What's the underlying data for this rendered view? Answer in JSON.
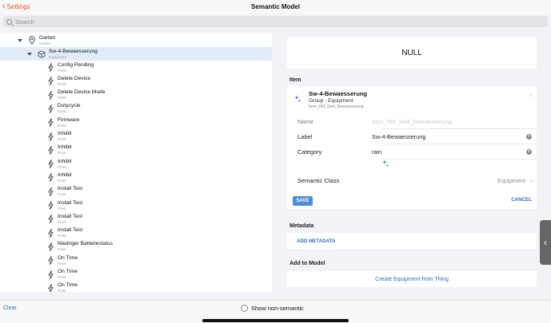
{
  "nav": {
    "back_label": "Settings",
    "title": "Semantic Model"
  },
  "search": {
    "placeholder": "Search"
  },
  "tree": {
    "location": {
      "label": "Garten",
      "sublabel": "Garten"
    },
    "equipment": {
      "label": "Sw-4-Bewaesserung",
      "sublabel": "Equipment"
    },
    "points": [
      {
        "label": "Config Pending",
        "sublabel": "Point"
      },
      {
        "label": "Delete Device",
        "sublabel": "Point"
      },
      {
        "label": "Delete Device Mode",
        "sublabel": "Point"
      },
      {
        "label": "Dutycycle",
        "sublabel": "Point"
      },
      {
        "label": "Firmware",
        "sublabel": "Point"
      },
      {
        "label": "Inhibit",
        "sublabel": "Point"
      },
      {
        "label": "Inhibit",
        "sublabel": "Point"
      },
      {
        "label": "Inhibit",
        "sublabel": "Point"
      },
      {
        "label": "Inhibit",
        "sublabel": "Point"
      },
      {
        "label": "Install Test",
        "sublabel": "Point"
      },
      {
        "label": "Install Test",
        "sublabel": "Point"
      },
      {
        "label": "Install Test",
        "sublabel": "Point"
      },
      {
        "label": "Install Test",
        "sublabel": "Point"
      },
      {
        "label": "Niedriger Batteriestatus",
        "sublabel": "Point"
      },
      {
        "label": "On Time",
        "sublabel": "Point"
      },
      {
        "label": "On Time",
        "sublabel": "Point"
      },
      {
        "label": "On Time",
        "sublabel": "Point"
      }
    ]
  },
  "detail": {
    "state": "NULL",
    "item_section": "Item",
    "item": {
      "name": "Sw-4-Bewaesserung",
      "type": "Group - Equipment",
      "item_name": "Item_HM_Sw4_Bewaesserung"
    },
    "fields": {
      "name_label": "Name",
      "name_placeholder": "Item_HM_Sw4_Bewaesserung",
      "label_label": "Label",
      "label_value": "Sw-4-Bewaesserung",
      "category_label": "Category",
      "category_value": "rain",
      "semantic_label": "Semantic Class",
      "semantic_value": "Equipment"
    },
    "save_label": "SAVE",
    "cancel_label": "CANCEL",
    "metadata_section": "Metadata",
    "add_metadata_label": "ADD METADATA",
    "add_model_section": "Add to Model",
    "create_equipment_label": "Create Equipment from Thing"
  },
  "bottom": {
    "clear_label": "Clear",
    "show_nonsemantic_label": "Show non-semantic"
  },
  "colors": {
    "accent_orange": "#e2571d",
    "link_blue": "#2a6fc9",
    "save_blue": "#4a90d9",
    "selected_row": "#e2ecf8"
  }
}
